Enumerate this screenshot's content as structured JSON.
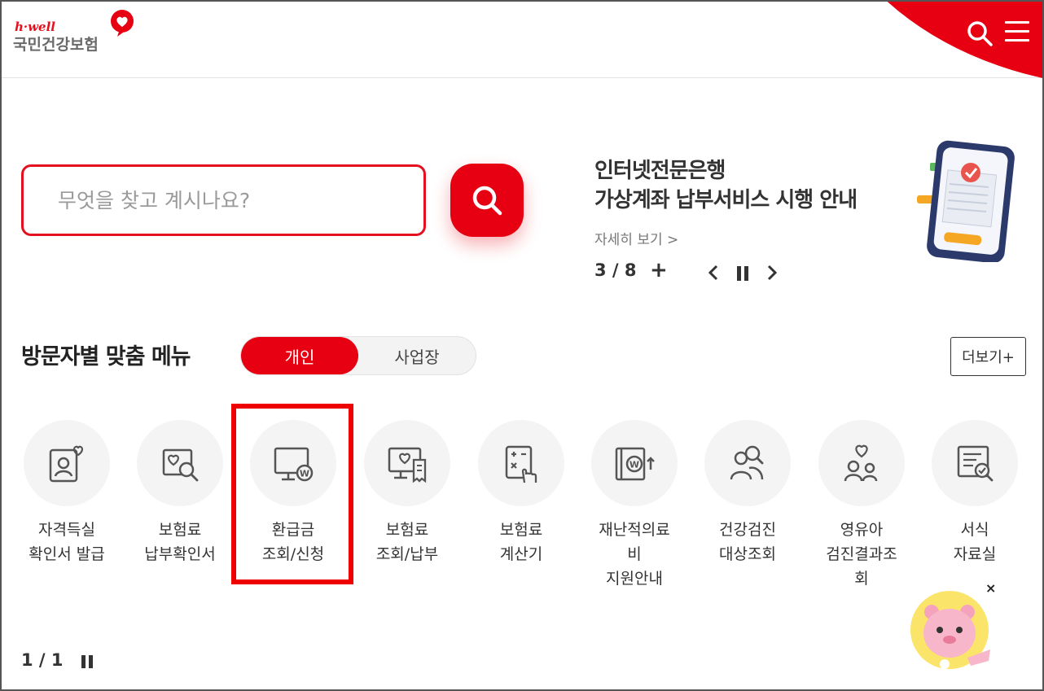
{
  "header": {
    "logo_small": "h·well",
    "logo_main": "국민건강보험"
  },
  "search": {
    "placeholder": "무엇을 찾고 계시나요?"
  },
  "banner": {
    "title_line1": "인터넷전문은행",
    "title_line2": "가상계좌 납부서비스 시행 안내",
    "more_link": "자세히 보기 >",
    "counter": "3 / 8",
    "plus": "+"
  },
  "section": {
    "title": "방문자별 맞춤 메뉴",
    "tab_personal": "개인",
    "tab_business": "사업장",
    "more_button": "더보기+"
  },
  "menu": [
    {
      "line1": "자격득실",
      "line2": "확인서 발급",
      "line3": ""
    },
    {
      "line1": "보험료",
      "line2": "납부확인서",
      "line3": ""
    },
    {
      "line1": "환급금",
      "line2": "조회/신청",
      "line3": ""
    },
    {
      "line1": "보험료",
      "line2": "조회/납부",
      "line3": ""
    },
    {
      "line1": "보험료",
      "line2": "계산기",
      "line3": ""
    },
    {
      "line1": "재난적의료",
      "line2": "비",
      "line3": "지원안내"
    },
    {
      "line1": "건강검진",
      "line2": "대상조회",
      "line3": ""
    },
    {
      "line1": "영유아",
      "line2": "검진결과조",
      "line3": "회"
    },
    {
      "line1": "서식",
      "line2": "자료실",
      "line3": ""
    }
  ],
  "pager": {
    "counter": "1 / 1"
  },
  "mascot": {
    "close": "×"
  },
  "colors": {
    "brand_red": "#e60012",
    "highlight_red": "#ef0000",
    "icon_gray": "#555555"
  }
}
